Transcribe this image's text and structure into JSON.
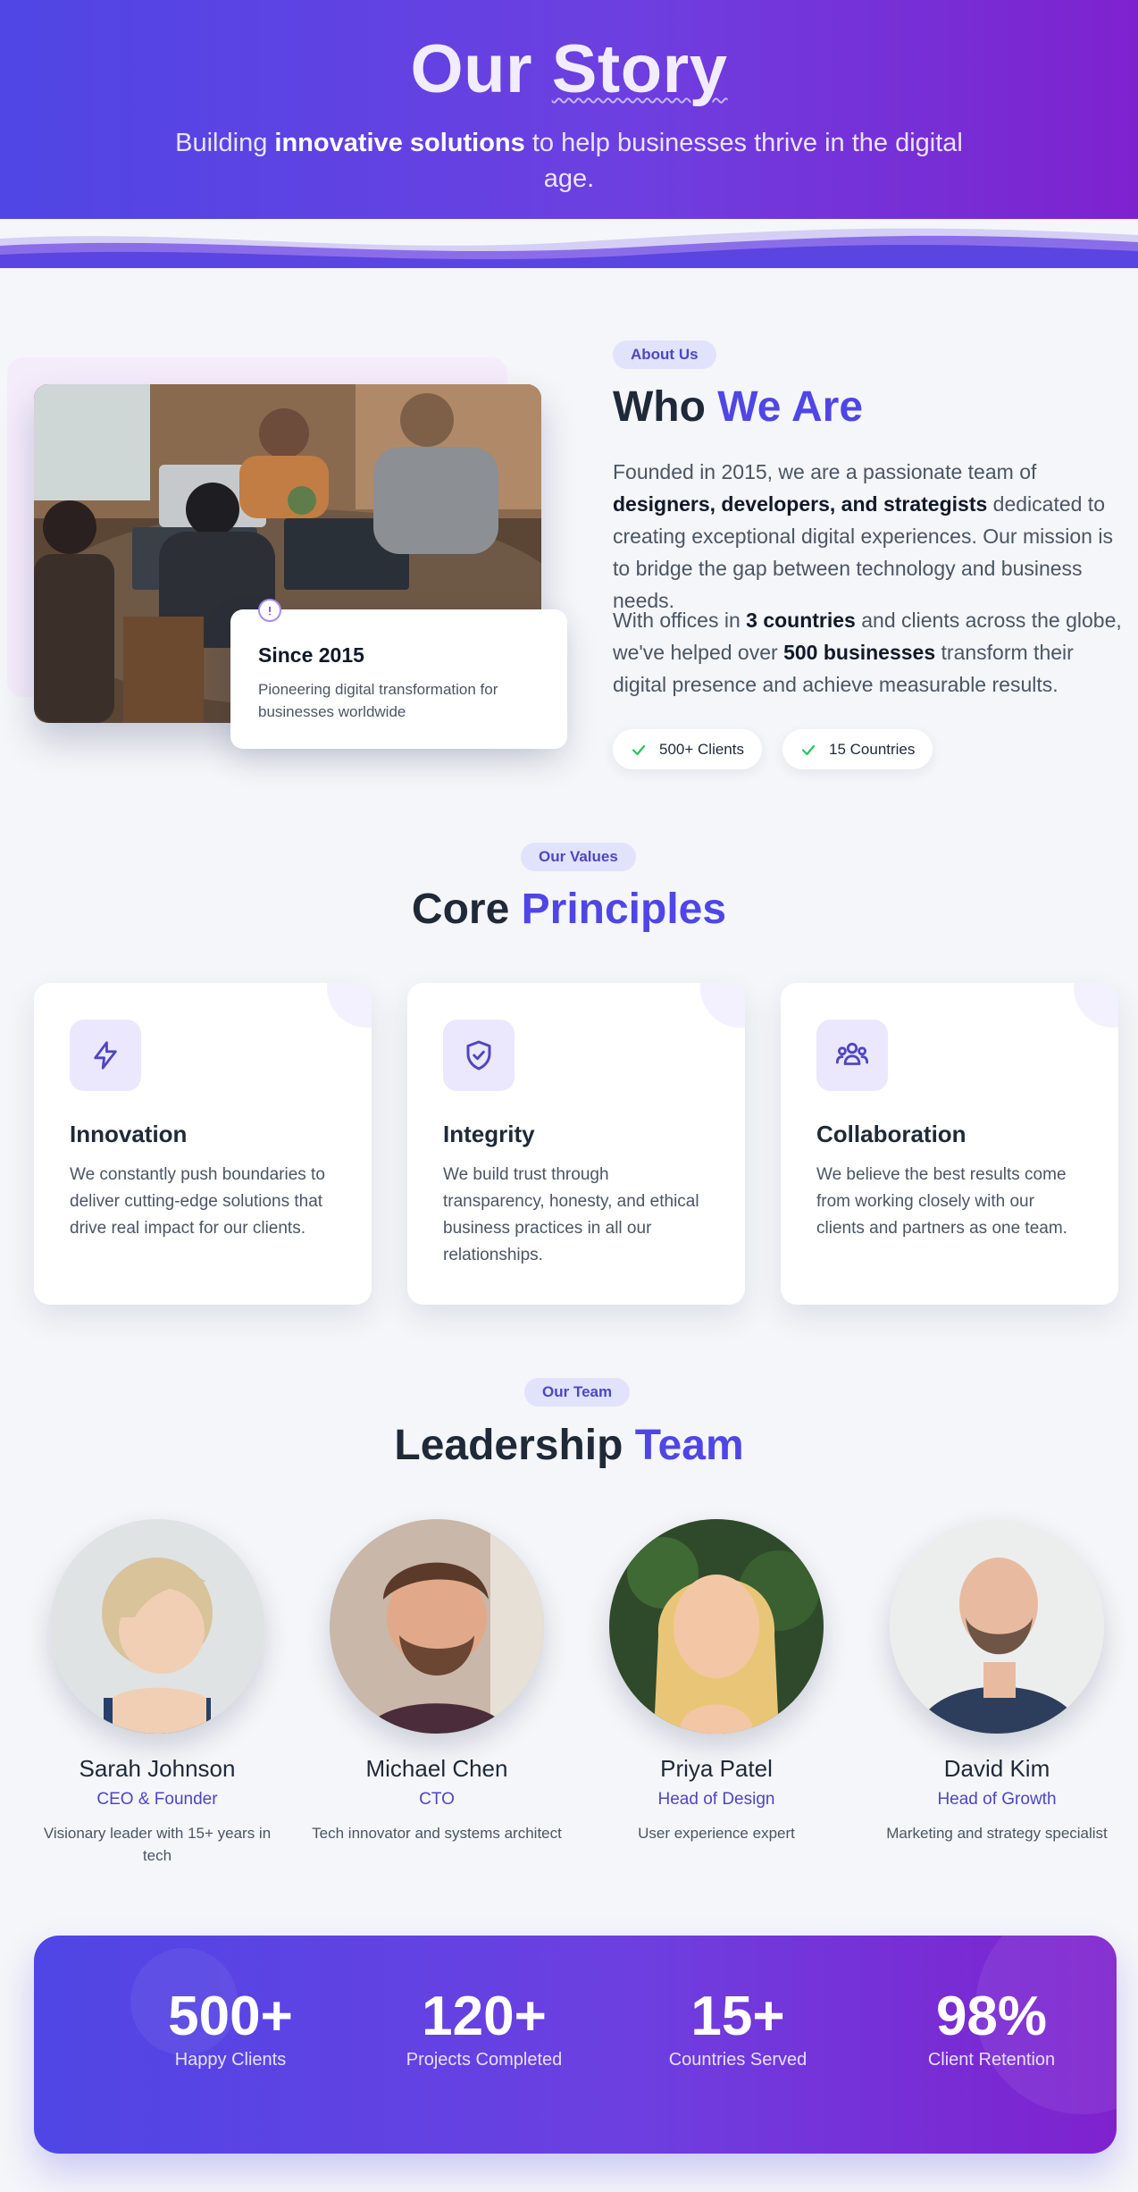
{
  "hero": {
    "title_a": "Our ",
    "title_b": "Story",
    "sub_a": "Building ",
    "sub_b": "innovative solutions",
    "sub_c": " to help businesses thrive in the digital age."
  },
  "about": {
    "tag": "About Us",
    "title_a": "Who ",
    "title_b": "We Are",
    "p1_a": "Founded in 2015, we are a passionate team of ",
    "p1_b": "designers, developers, and strategists",
    "p1_c": " dedicated to creating exceptional digital experiences. Our mission is to bridge the gap between technology and business needs.",
    "p2_a": "With offices in ",
    "p2_b": "3 countries",
    "p2_c": " and clients across the globe, we've helped over ",
    "p2_d": "500 businesses",
    "p2_e": " transform their digital presence and achieve measurable results.",
    "since_title": "Since 2015",
    "since_desc": "Pioneering digital transformation for businesses worldwide",
    "pills": [
      "500+ Clients",
      "15 Countries"
    ]
  },
  "values": {
    "tag": "Our Values",
    "title_a": "Core ",
    "title_b": "Principles",
    "cards": [
      {
        "icon": "lightning-icon",
        "title": "Innovation",
        "desc": "We constantly push boundaries to deliver cutting-edge solutions that drive real impact for our clients."
      },
      {
        "icon": "shield-check-icon",
        "title": "Integrity",
        "desc": "We build trust through transparency, honesty, and ethical business practices in all our relationships."
      },
      {
        "icon": "users-icon",
        "title": "Collaboration",
        "desc": "We believe the best results come from working closely with our clients and partners as one team."
      }
    ]
  },
  "team": {
    "tag": "Our Team",
    "title_a": "Leadership ",
    "title_b": "Team",
    "members": [
      {
        "name": "Sarah Johnson",
        "role": "CEO & Founder",
        "desc": "Visionary leader with 15+ years in tech"
      },
      {
        "name": "Michael Chen",
        "role": "CTO",
        "desc": "Tech innovator and systems architect"
      },
      {
        "name": "Priya Patel",
        "role": "Head of Design",
        "desc": "User experience expert"
      },
      {
        "name": "David Kim",
        "role": "Head of Growth",
        "desc": "Marketing and strategy specialist"
      }
    ]
  },
  "stats": [
    {
      "num": "500+",
      "label": "Happy Clients"
    },
    {
      "num": "120+",
      "label": "Projects Completed"
    },
    {
      "num": "15+",
      "label": "Countries Served"
    },
    {
      "num": "98%",
      "label": "Client Retention"
    }
  ],
  "colors": {
    "accent": "#4f46e5",
    "gradient_start": "#4f46e5",
    "gradient_end": "#7e22ce",
    "check": "#22c55e"
  }
}
